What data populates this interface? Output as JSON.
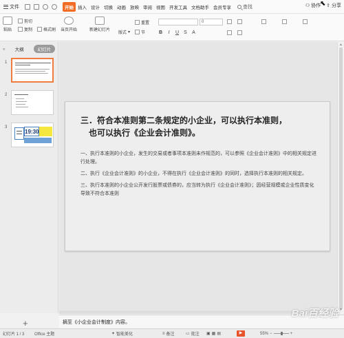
{
  "menubar": {
    "file_label": "文件",
    "tabs": [
      "开始",
      "插入",
      "设计",
      "切换",
      "动画",
      "放映",
      "审阅",
      "视图",
      "开发工具",
      "文档助手",
      "会员专享"
    ],
    "active_tab": 0,
    "search_label": "查找",
    "collab_label": "协作",
    "share_label": "分享"
  },
  "ribbon": {
    "paste": "粘贴",
    "cut": "剪切",
    "copy": "复制",
    "format_painter": "格式刷",
    "from_current": "当页开始",
    "new_slide": "新建幻灯片",
    "layout": "版式",
    "section": "节",
    "reset": "重置",
    "font_size": "0"
  },
  "leftpanel": {
    "collapse": "«",
    "tab_outline": "大纲",
    "tab_slides": "幻灯片",
    "slide_numbers": [
      "1",
      "2",
      "3"
    ],
    "thumb3_time": "19:30",
    "add_slide": "+"
  },
  "slide": {
    "title_line1": "三．符合本准则第二条规定的小企业，可以执行本准则，",
    "title_line2": "也可以执行《企业会计准则》。",
    "paragraphs": [
      "一、执行本准则的小企业，发生的交易或者事项本准则未作规范的，可以参照《企业会计准则》中的相关规定进行处理。",
      "二、执行《企业会计准则》的小企业，不得在执行《企业会计准则》的同时，选择执行本准则的相关规定。",
      "三、执行本准则的小企业公开发行股票或债券的，应当转为执行《企业会计准则》；因经营规模或企业性质变化导致不符合本准则"
    ]
  },
  "notes": {
    "text": "摘至《小企业会计制度》内容。"
  },
  "statusbar": {
    "slide_counter": "幻灯片 1 / 3",
    "theme": "Office 主题",
    "smart_beautify": "智能美化",
    "notes_label": "备注",
    "comments_label": "批注",
    "zoom_percent": "55%",
    "zoom_minus": "−",
    "zoom_plus": "+"
  },
  "watermark": "Bai百经验"
}
